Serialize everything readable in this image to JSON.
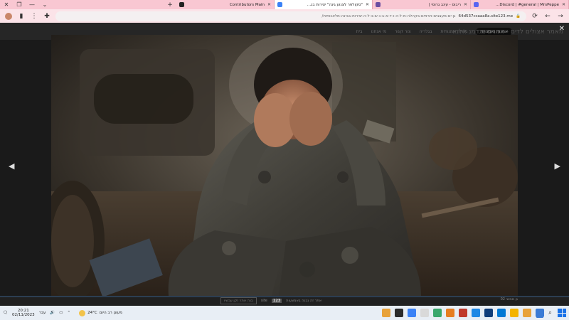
{
  "browser": {
    "tabs": [
      {
        "label": "Discord | #general | MrsPeppe...",
        "active": false,
        "fav_color": "#5865F2"
      },
      {
        "label": "ריבוס - עינב גרוסי |",
        "active": false,
        "fav_color": "#6a4ea1"
      },
      {
        "label": "\"סקולפר לצנוע גינה\" יצירות בנ...",
        "active": true,
        "fav_color": "#3b82f6"
      },
      {
        "label": "Contributors Main",
        "active": false,
        "fav_color": "#222222"
      }
    ],
    "url_host": "64d537ccaaa8a.site123.me",
    "url_path": "/גן-ים-מעצבים-תרמים-בקהלה-מ-ל-ה-ו-ד-א-ב-נ-ש-ב-ל-ה-יצירות-בבינה-מלאכותית"
  },
  "page": {
    "bg_title": "מאמר אצולים לדים - אמנים בגדמנ אלמו",
    "nav_items": [
      "בית",
      "מי אנחנו",
      "צור קשר",
      "בגלריה",
      "גלריה אמנותית",
      "אמנות ואמנויות"
    ],
    "nav_active": "אמנות ואמנויות",
    "caption_right": "גן ממשי 02",
    "caption_center_text": "אתר זה נבנה באמצעות",
    "caption_center_brand": "123",
    "caption_center_brand_tail": "site",
    "caption_button": "בנה אתר זקן עכשיו"
  },
  "lightbox": {
    "close_label": "✕",
    "prev_label": "◀",
    "next_label": "▶"
  },
  "taskbar": {
    "time": "20:21",
    "date": "02/11/2023",
    "lang": "עבר",
    "temp": "24°C",
    "weather_text": "מעונן רב היום",
    "app_colors": [
      "#e8a23a",
      "#2b2b2b",
      "#3b82f6",
      "#d9d9d9",
      "#3aa76d",
      "#e67e22",
      "#c0392b",
      "#1e88e5",
      "#0f3d7a",
      "#0078d4",
      "#f4b400",
      "#e8a23a",
      "#3a7bd5"
    ]
  },
  "colors": {
    "tabbar": "#f9c7d2",
    "accent": "#3a7bd5"
  }
}
